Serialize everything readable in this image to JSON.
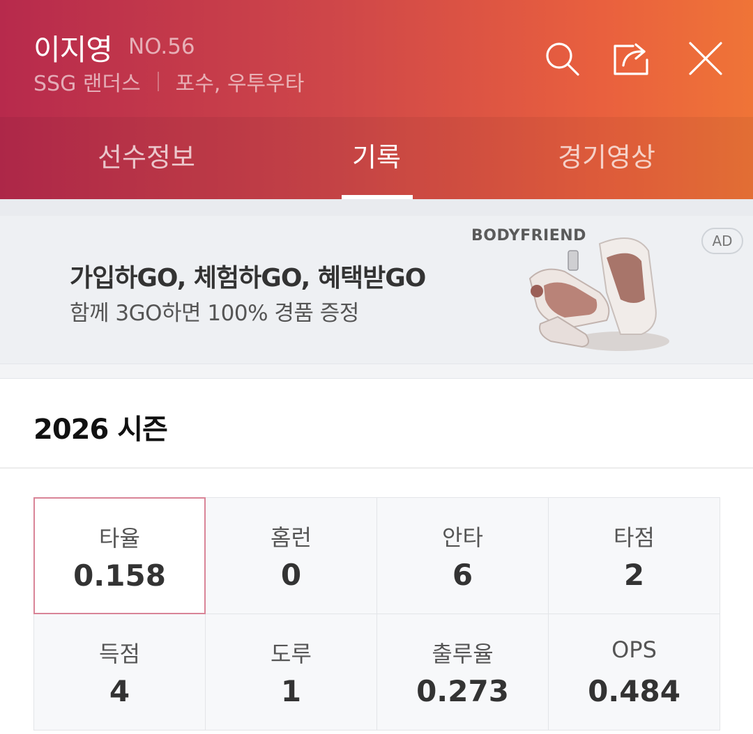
{
  "header": {
    "player_name": "이지영",
    "player_number": "NO.56",
    "team": "SSG 랜더스",
    "position": "포수, 우투우타",
    "icons": [
      "search-icon",
      "share-icon",
      "close-icon"
    ],
    "gradient_colors": [
      "#b72a4c",
      "#ef7437"
    ]
  },
  "tabs": [
    {
      "label": "선수정보",
      "active": false
    },
    {
      "label": "기록",
      "active": true
    },
    {
      "label": "경기영상",
      "active": false
    }
  ],
  "ad": {
    "headline": "가입하GO, 체험하GO, 혜택받GO",
    "subline": "함께 3GO하면 100% 경품 증정",
    "brand": "BODYFRIEND",
    "badge": "AD"
  },
  "season": {
    "title": "2026 시즌"
  },
  "stats": [
    {
      "label": "타율",
      "value": "0.158",
      "selected": true
    },
    {
      "label": "홈런",
      "value": "0"
    },
    {
      "label": "안타",
      "value": "6"
    },
    {
      "label": "타점",
      "value": "2"
    },
    {
      "label": "득점",
      "value": "4"
    },
    {
      "label": "도루",
      "value": "1"
    },
    {
      "label": "출루율",
      "value": "0.273"
    },
    {
      "label": "OPS",
      "value": "0.484"
    }
  ],
  "colors": {
    "selected_border": "#d98497",
    "cell_background": "#f7f8fa"
  }
}
